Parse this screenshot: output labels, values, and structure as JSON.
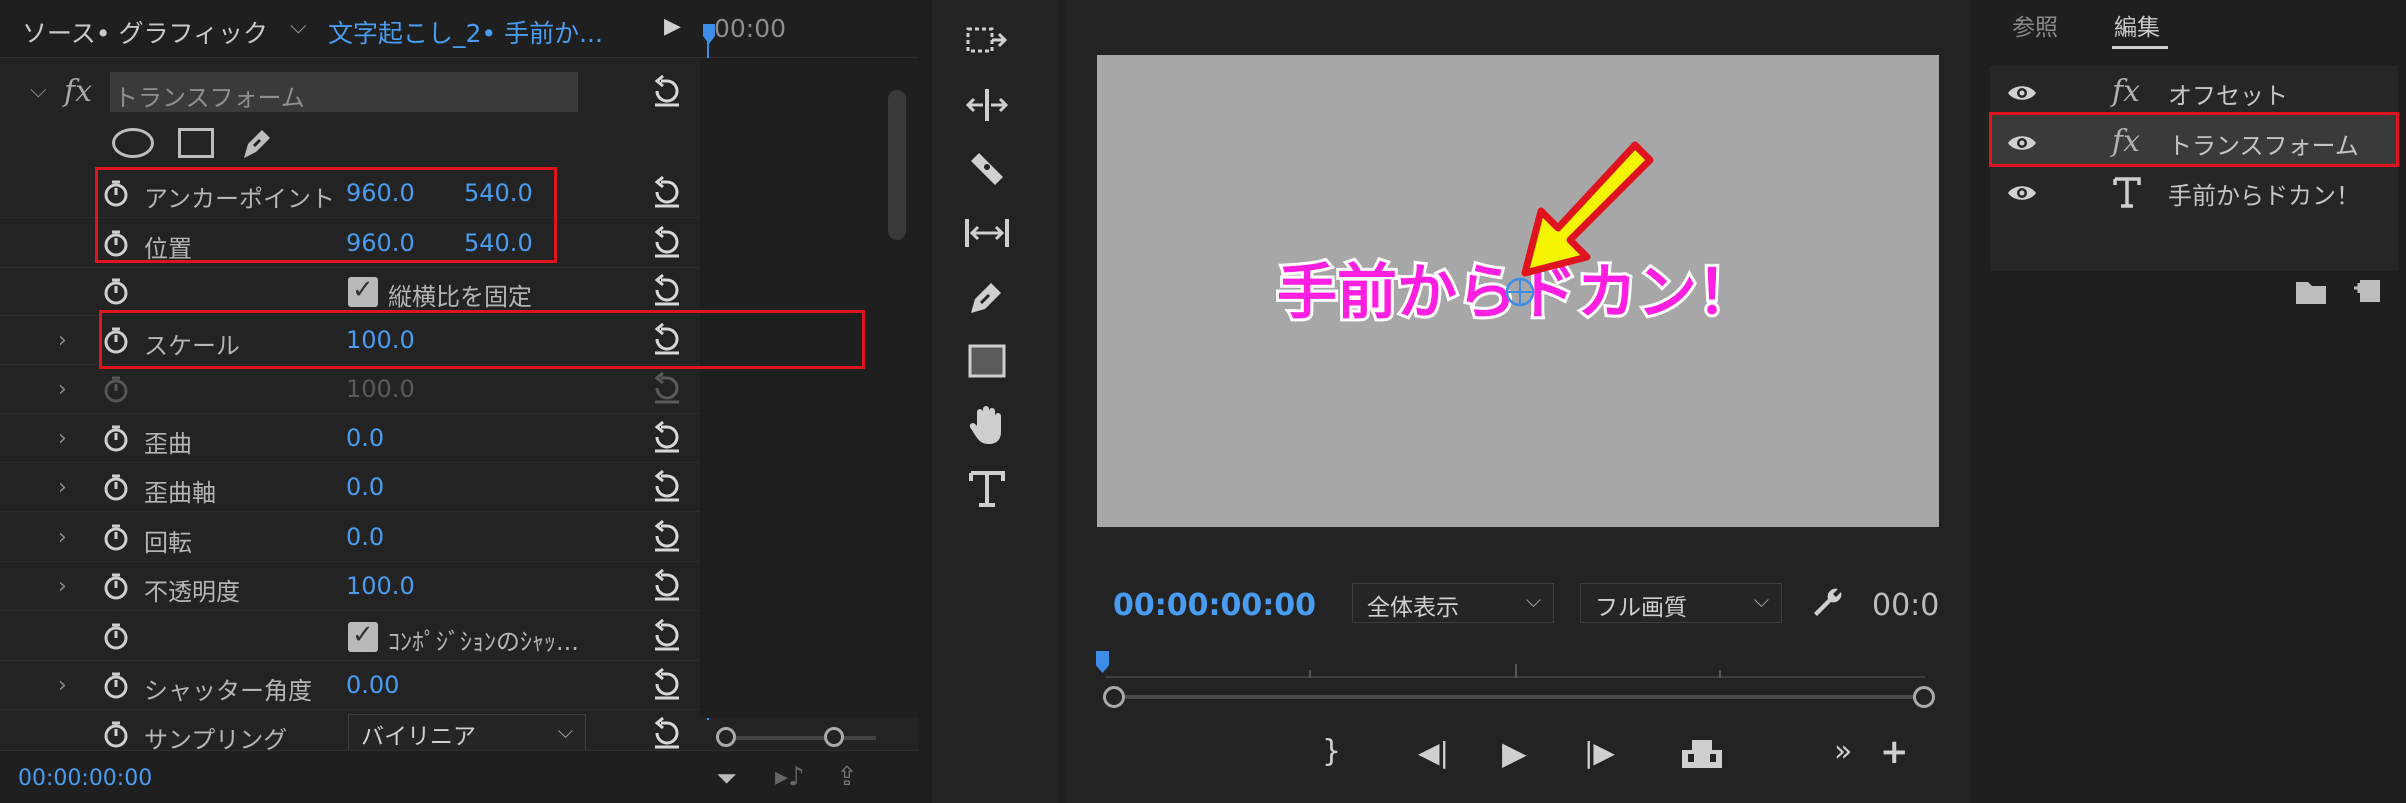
{
  "source_panel": {
    "tab_title": "ソース• グラフィック",
    "clip_name": "文字起こし_2• 手前か...",
    "timecode_head": "00:00",
    "effect_name": "トランスフォーム",
    "properties": [
      {
        "label": "アンカーポイント",
        "v1": "960.0",
        "v2": "540.0"
      },
      {
        "label": "位置",
        "v1": "960.0",
        "v2": "540.0"
      },
      {
        "label": "縦横比を固定",
        "checkbox": true
      },
      {
        "label": "スケール",
        "v1": "100.0"
      },
      {
        "label": "",
        "v1": "100.0"
      },
      {
        "label": "歪曲",
        "v1": "0.0"
      },
      {
        "label": "歪曲軸",
        "v1": "0.0"
      },
      {
        "label": "回転",
        "v1": "0.0"
      },
      {
        "label": "不透明度",
        "v1": "100.0"
      },
      {
        "label": "ｺﾝﾎﾟｼﾞｼｮﾝのｼｬｯ...",
        "checkbox": true
      },
      {
        "label": "シャッター角度",
        "v1": "0.00"
      },
      {
        "label": "サンプリング",
        "dropdown": "バイリニア"
      }
    ],
    "footer_timecode": "00:00:00:00"
  },
  "program_panel": {
    "title_text": "手前からドカン！",
    "timecode": "00:00:00:00",
    "zoom_select": "全体表示",
    "quality_select": "フル画質",
    "timecode_right": "00:0"
  },
  "graphics_panel": {
    "tab_browse": "参照",
    "tab_edit": "編集",
    "layers": [
      {
        "icon": "fx",
        "label": "オフセット"
      },
      {
        "icon": "fx",
        "label": "トランスフォーム"
      },
      {
        "icon": "T",
        "label": "手前からドカン！"
      }
    ]
  },
  "colors": {
    "accent_blue": "#4a9cf0",
    "highlight_red": "#e0141e",
    "title_magenta": "#ff1fe0",
    "arrow_yellow": "#f5f500"
  }
}
